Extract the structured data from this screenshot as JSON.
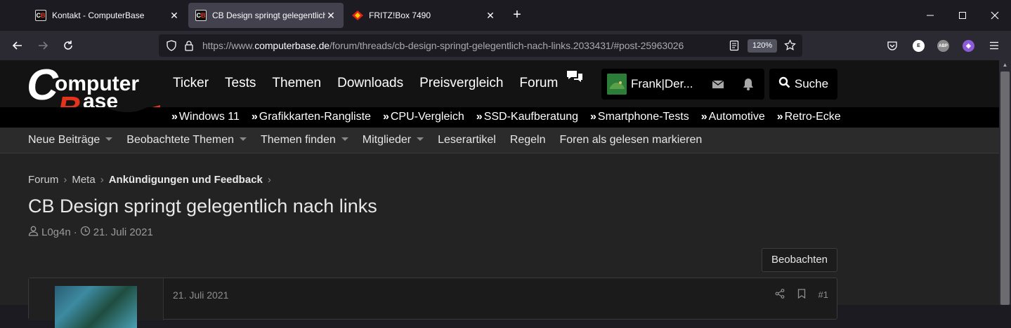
{
  "browser": {
    "tabs": [
      {
        "label": "Kontakt - ComputerBase",
        "favicon": "computerbase-favicon"
      },
      {
        "label": "CB Design springt gelegentlich nach links",
        "favicon": "computerbase-favicon"
      },
      {
        "label": "FRITZ!Box 7490",
        "favicon": "fritzbox-favicon"
      }
    ],
    "tab_close_glyph": "✕",
    "new_tab_glyph": "+",
    "url_prefix": "https://www.",
    "url_domain": "computerbase.de",
    "url_path": "/forum/threads/cb-design-springt-gelegentlich-nach-links.2033431/#post-25963026",
    "zoom": "120%",
    "extensions": [
      {
        "name": "e-extension-icon",
        "label": "E"
      },
      {
        "name": "adblock-plus-icon",
        "label": "ABP"
      },
      {
        "name": "tor-extension-icon",
        "label": "◈"
      }
    ]
  },
  "site": {
    "logo": {
      "line1": "omputer",
      "line2": "ase",
      "c": "C",
      "b": "B"
    },
    "main_nav": [
      "Ticker",
      "Tests",
      "Themen",
      "Downloads",
      "Preisvergleich",
      "Forum"
    ],
    "user": {
      "name": "Frank|Der..."
    },
    "search_label": "Suche",
    "sub_nav": [
      "Windows 11",
      "Grafikkarten-Rangliste",
      "CPU-Vergleich",
      "SSD-Kaufberatung",
      "Smartphone-Tests",
      "Automotive",
      "Retro-Ecke"
    ],
    "sub_nav_marker": "»",
    "forum_nav": [
      {
        "label": "Neue Beiträge",
        "dropdown": true
      },
      {
        "label": "Beobachtete Themen",
        "dropdown": true
      },
      {
        "label": "Themen finden",
        "dropdown": true
      },
      {
        "label": "Mitglieder",
        "dropdown": true
      },
      {
        "label": "Leserartikel",
        "dropdown": false
      },
      {
        "label": "Regeln",
        "dropdown": false
      },
      {
        "label": "Foren als gelesen markieren",
        "dropdown": false
      }
    ]
  },
  "thread": {
    "breadcrumb": [
      "Forum",
      "Meta",
      "Ankündigungen und Feedback"
    ],
    "breadcrumb_sep": "›",
    "title": "CB Design springt gelegentlich nach links",
    "author": "L0g4n",
    "meta_sep": "·",
    "date": "21. Juli 2021",
    "watch_label": "Beobachten",
    "post": {
      "date": "21. Juli 2021",
      "number": "#1"
    }
  },
  "colors": {
    "accent_red": "#e4321b",
    "header_bg": "#131313",
    "page_bg": "#232323"
  }
}
